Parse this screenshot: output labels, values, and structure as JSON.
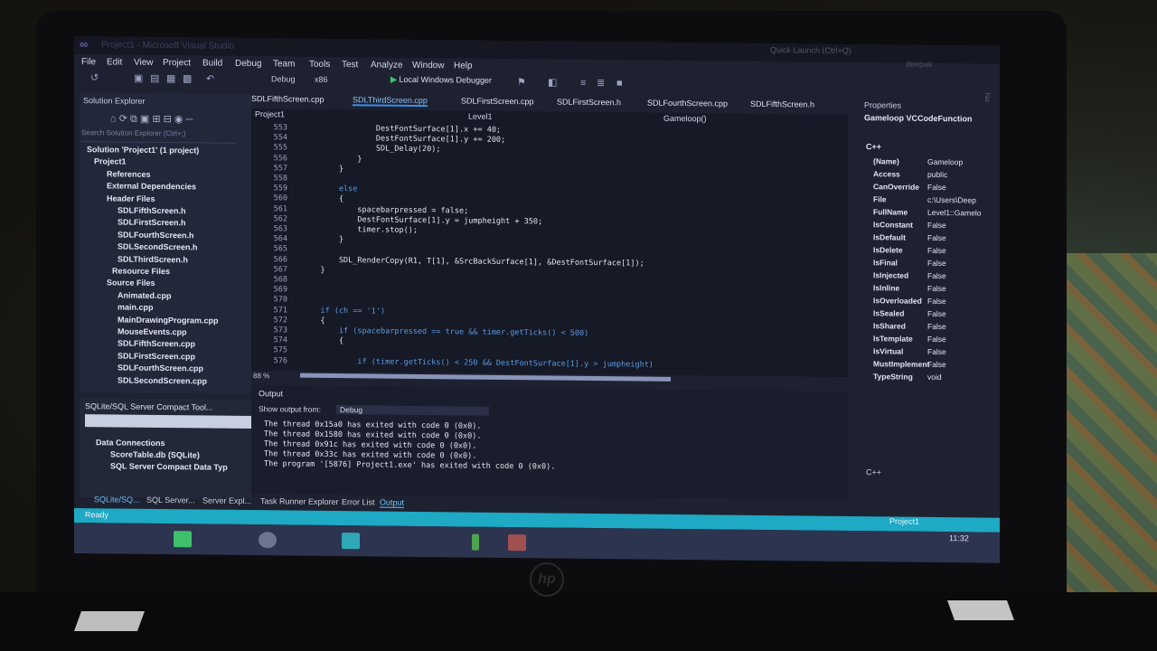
{
  "window": {
    "title": "Project1 - Microsoft Visual Studio",
    "quick_launch": "Quick Launch (Ctrl+Q)",
    "user": "deepak",
    "notifications": "Notifications"
  },
  "menu": [
    "File",
    "Edit",
    "View",
    "Project",
    "Build",
    "Debug",
    "Team",
    "Tools",
    "Test",
    "Analyze",
    "Window",
    "Help"
  ],
  "toolbar": {
    "config": "Debug",
    "platform": "x86",
    "run_label": "Local Windows Debugger"
  },
  "solution_explorer": {
    "title": "Solution Explorer",
    "search_placeholder": "Search Solution Explorer (Ctrl+;)",
    "items": [
      "Solution 'Project1' (1 project)",
      "Project1",
      "References",
      "External Dependencies",
      "Header Files",
      "SDLFifthScreen.h",
      "SDLFirstScreen.h",
      "SDLFourthScreen.h",
      "SDLSecondScreen.h",
      "SDLThirdScreen.h",
      "Resource Files",
      "Source Files",
      "Animated.cpp",
      "main.cpp",
      "MainDrawingProgram.cpp",
      "MouseEvents.cpp",
      "SDLFifthScreen.cpp",
      "SDLFirstScreen.cpp",
      "SDLFourthScreen.cpp",
      "SDLSecondScreen.cpp"
    ]
  },
  "sqlite_panel": {
    "title": "SQLite/SQL Server Compact Tool...",
    "items": [
      "Data Connections",
      "ScoreTable.db (SQLite)",
      "SQL Server Compact Data Typ"
    ]
  },
  "editor": {
    "tabs": [
      "SDLFifthScreen.cpp",
      "SDLThirdScreen.cpp",
      "SDLFirstScreen.cpp",
      "SDLFirstScreen.h",
      "SDLFourthScreen.cpp",
      "SDLFifthScreen.h"
    ],
    "active_tab": "SDLThirdScreen.cpp",
    "nav_left": "Project1",
    "nav_mid": "Level1",
    "nav_right": "Gameloop()",
    "zoom": "88 %",
    "lines": [
      {
        "n": "553",
        "code": "                DestFontSurface[1].x += 40;"
      },
      {
        "n": "554",
        "code": "                DestFontSurface[1].y += 200;"
      },
      {
        "n": "555",
        "code": "                SDL_Delay(20);"
      },
      {
        "n": "556",
        "code": "            }"
      },
      {
        "n": "557",
        "code": "        }"
      },
      {
        "n": "558",
        "code": ""
      },
      {
        "n": "559",
        "code": "        else"
      },
      {
        "n": "560",
        "code": "        {"
      },
      {
        "n": "561",
        "code": "            spacebarpressed = false;"
      },
      {
        "n": "562",
        "code": "            DestFontSurface[1].y = jumpheight + 350;"
      },
      {
        "n": "563",
        "code": "            timer.stop();"
      },
      {
        "n": "564",
        "code": "        }"
      },
      {
        "n": "565",
        "code": ""
      },
      {
        "n": "566",
        "code": "        SDL_RenderCopy(R1, T[1], &SrcBackSurface[1], &DestFontSurface[1]);"
      },
      {
        "n": "567",
        "code": "    }"
      },
      {
        "n": "568",
        "code": ""
      },
      {
        "n": "569",
        "code": ""
      },
      {
        "n": "570",
        "code": ""
      },
      {
        "n": "571",
        "code": "    if (ch == '1')"
      },
      {
        "n": "572",
        "code": "    {"
      },
      {
        "n": "573",
        "code": "        if (spacebarpressed == true && timer.getTicks() < 500)"
      },
      {
        "n": "574",
        "code": "        {"
      },
      {
        "n": "575",
        "code": ""
      },
      {
        "n": "576",
        "code": "            if (timer.getTicks() < 250 && DestFontSurface[1].y > jumpheight)"
      }
    ]
  },
  "output": {
    "title": "Output",
    "show_from_label": "Show output from:",
    "show_from_value": "Debug",
    "lines": [
      "The thread 0x15a0 has exited with code 0 (0x0).",
      "The thread 0x1580 has exited with code 0 (0x0).",
      "The thread 0x91c has exited with code 0 (0x0).",
      "The thread 0x33c has exited with code 0 (0x0).",
      "The program '[5876] Project1.exe' has exited with code 0 (0x0)."
    ]
  },
  "bottom_tabs": {
    "left": [
      "SQLite/SQ...",
      "SQL Server...",
      "Server Expl..."
    ],
    "center": [
      "Task Runner Explorer",
      "Error List",
      "Output"
    ]
  },
  "properties": {
    "title": "Properties",
    "object": "Gameloop  VCCodeFunction",
    "section": "C++",
    "rows": [
      {
        "k": "(Name)",
        "v": "Gameloop"
      },
      {
        "k": "Access",
        "v": "public"
      },
      {
        "k": "CanOverride",
        "v": "False"
      },
      {
        "k": "File",
        "v": "c:\\Users\\Deep"
      },
      {
        "k": "FullName",
        "v": "Level1::Gamelo"
      },
      {
        "k": "IsConstant",
        "v": "False"
      },
      {
        "k": "IsDefault",
        "v": "False"
      },
      {
        "k": "IsDelete",
        "v": "False"
      },
      {
        "k": "IsFinal",
        "v": "False"
      },
      {
        "k": "IsInjected",
        "v": "False"
      },
      {
        "k": "IsInline",
        "v": "False"
      },
      {
        "k": "IsOverloaded",
        "v": "False"
      },
      {
        "k": "IsSealed",
        "v": "False"
      },
      {
        "k": "IsShared",
        "v": "False"
      },
      {
        "k": "IsTemplate",
        "v": "False"
      },
      {
        "k": "IsVirtual",
        "v": "False"
      },
      {
        "k": "MustImplement",
        "v": "False"
      },
      {
        "k": "TypeString",
        "v": "void"
      }
    ],
    "footer": "C++"
  },
  "status": {
    "text": "Ready",
    "project": "Project1",
    "time": "11:32"
  },
  "colors": {
    "accent": "#1ea9c4",
    "keyword": "#5a9be2",
    "run": "#3ec36b"
  }
}
